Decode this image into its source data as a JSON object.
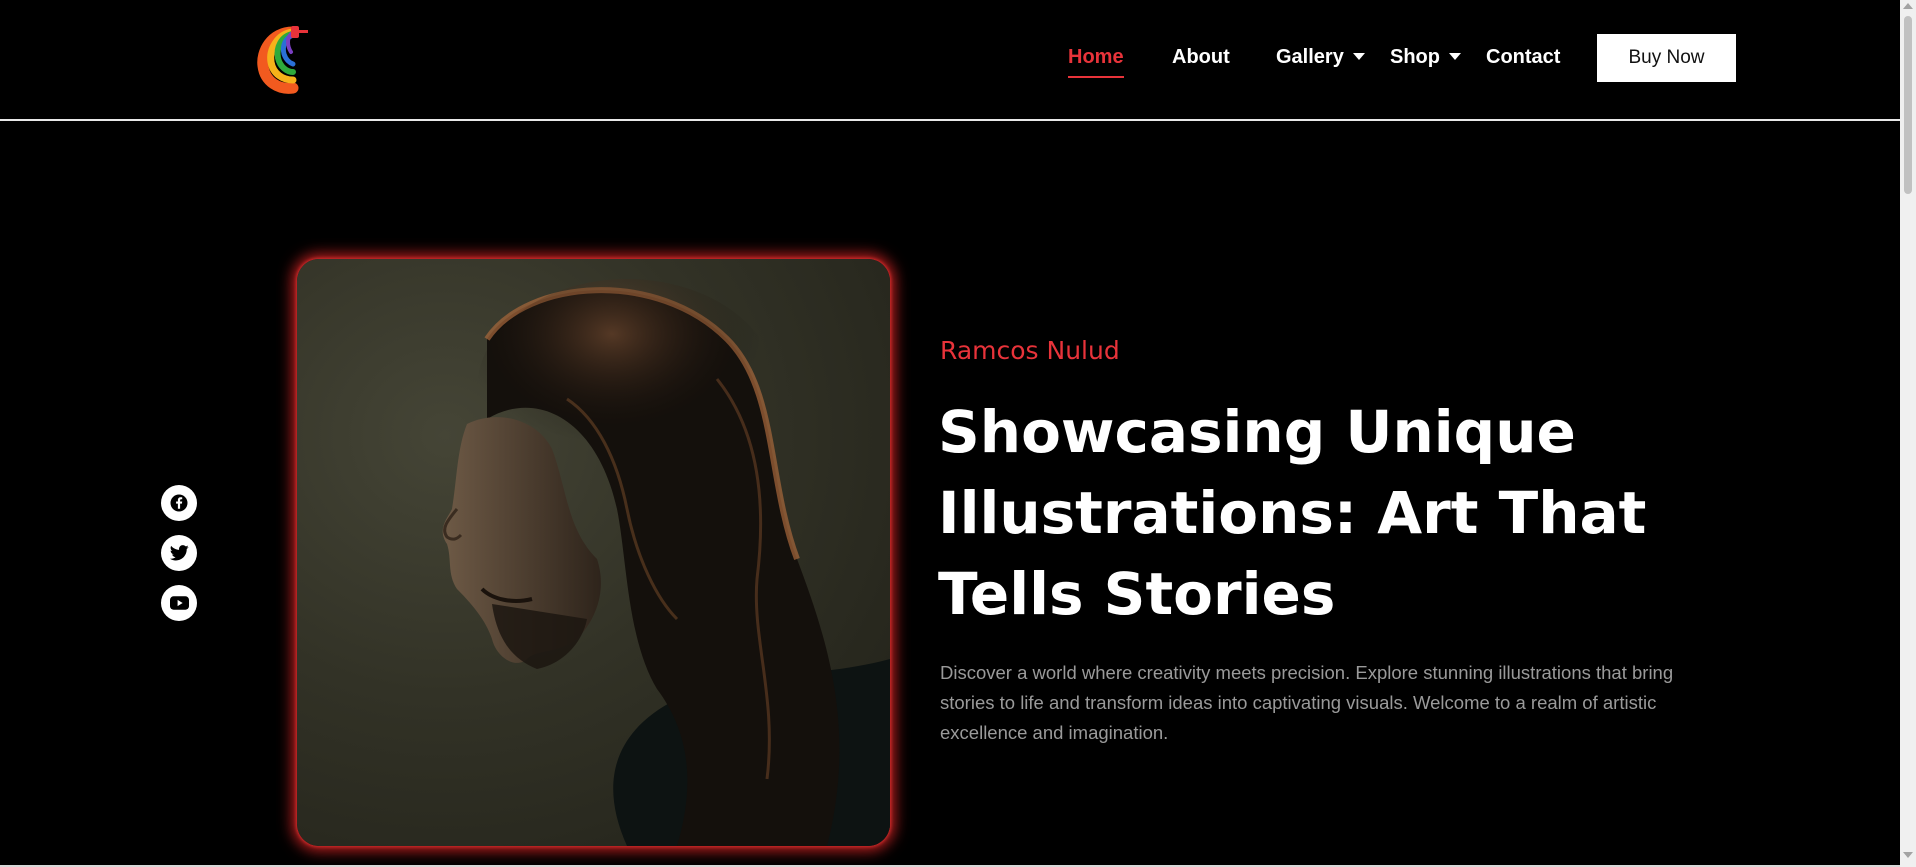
{
  "header": {
    "logo_icon": "paint-brush-rainbow-logo",
    "nav": [
      {
        "label": "Home",
        "active": true,
        "has_dropdown": false
      },
      {
        "label": "About",
        "active": false,
        "has_dropdown": false
      },
      {
        "label": "Gallery",
        "active": false,
        "has_dropdown": true
      },
      {
        "label": "Shop",
        "active": false,
        "has_dropdown": true
      },
      {
        "label": "Contact",
        "active": false,
        "has_dropdown": false
      }
    ],
    "cta_label": "Buy Now"
  },
  "socials": [
    {
      "icon": "facebook-icon"
    },
    {
      "icon": "twitter-icon"
    },
    {
      "icon": "youtube-icon"
    }
  ],
  "hero": {
    "artist_name": "Ramcos Nulud",
    "headline": "Showcasing Unique Illustrations: Art That Tells Stories",
    "description": "Discover a world where creativity meets precision. Explore stunning illustrations that bring stories to life and transform ideas into captivating visuals. Welcome to a realm of artistic excellence and imagination."
  },
  "colors": {
    "accent": "#e8333a",
    "background": "#000000",
    "text": "#ffffff",
    "muted_text": "#9a9a9a",
    "portrait_glow": "#d62525"
  }
}
